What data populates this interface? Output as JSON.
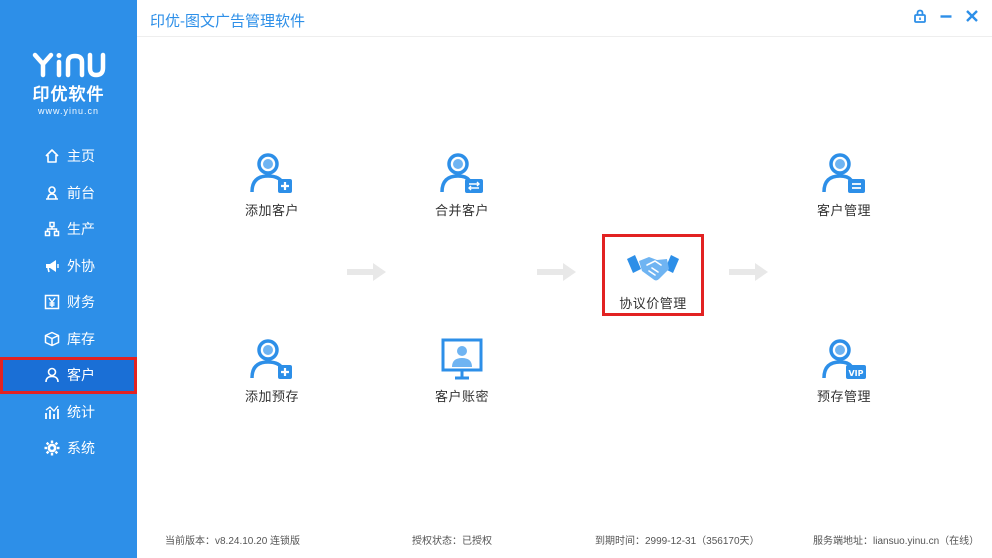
{
  "app": {
    "title": "印优-图文广告管理软件",
    "accent": "#2d8fe8",
    "highlight": "#e22222"
  },
  "logo": {
    "mark": "YINU",
    "name": "印优软件",
    "url": "www.yinu.cn"
  },
  "sidebar": {
    "items": [
      {
        "label": "主页",
        "icon": "home-icon"
      },
      {
        "label": "前台",
        "icon": "person-desk-icon"
      },
      {
        "label": "生产",
        "icon": "org-chart-icon"
      },
      {
        "label": "外协",
        "icon": "megaphone-icon"
      },
      {
        "label": "财务",
        "icon": "yen-icon"
      },
      {
        "label": "库存",
        "icon": "box-icon"
      },
      {
        "label": "客户",
        "icon": "user-icon",
        "active": true
      },
      {
        "label": "统计",
        "icon": "chart-icon"
      },
      {
        "label": "系统",
        "icon": "gear-icon"
      }
    ]
  },
  "window": {
    "lock": "lock-icon",
    "minimize": "minimize-icon",
    "close": "close-icon"
  },
  "tiles": {
    "add_customer": "添加客户",
    "merge_customer": "合并客户",
    "negotiated_price": "协议价管理",
    "customer_manage": "客户管理",
    "add_prepaid": "添加预存",
    "customer_account": "客户账密",
    "prepaid_manage": "预存管理"
  },
  "status": {
    "version": "当前版本：v8.24.10.20  连锁版",
    "license": "授权状态：已授权",
    "expiry": "到期时间：2999-12-31（356170天）",
    "server": "服务端地址：liansuo.yinu.cn（在线）"
  }
}
